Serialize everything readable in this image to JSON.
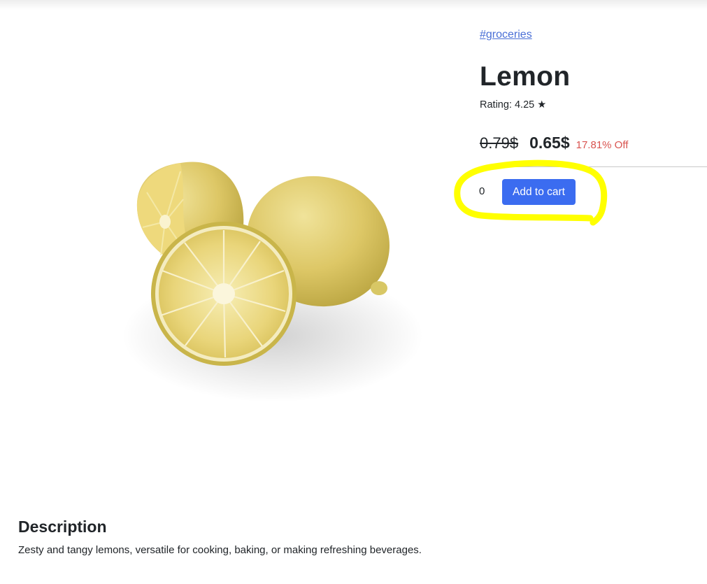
{
  "product": {
    "category_tag": "#groceries",
    "title": "Lemon",
    "rating_text": "Rating: 4.25 ★",
    "original_price": "0.79$",
    "sale_price": "0.65$",
    "discount_text": "17.81% Off",
    "image_alt": "lemon-product-image"
  },
  "cart": {
    "quantity_value": "0",
    "add_label": "Add to cart"
  },
  "description": {
    "heading": "Description",
    "text": "Zesty and tangy lemons, versatile for cooking, baking, or making refreshing beverages."
  },
  "colors": {
    "link": "#4a6fd6",
    "button": "#3b6cf0",
    "discount": "#d9534f",
    "highlight": "#ffff00"
  }
}
